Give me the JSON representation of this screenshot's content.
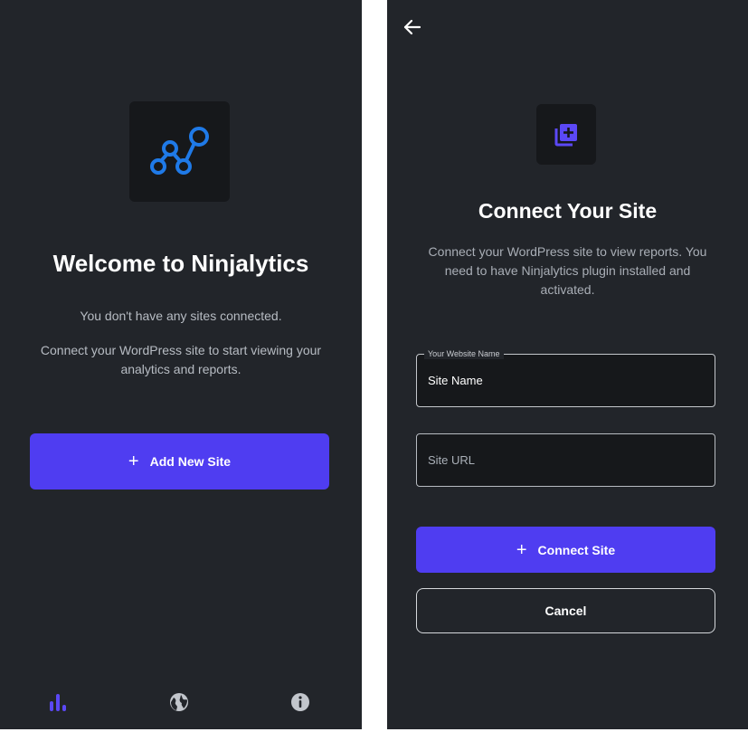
{
  "colors": {
    "background": "#22252a",
    "tile": "#16181b",
    "accent": "#4f3df1",
    "logo_blue": "#1f7ae8",
    "muted_text": "#b7bcc3"
  },
  "welcome": {
    "logo_icon": "network-graph-icon",
    "title": "Welcome to Ninjalytics",
    "empty_message": "You don't have any sites connected.",
    "connect_message": "Connect your WordPress site to start viewing your analytics and reports.",
    "add_button_label": "Add New Site",
    "add_button_icon": "plus-icon",
    "nav": [
      {
        "icon": "bar-chart-icon",
        "active": true
      },
      {
        "icon": "globe-icon",
        "active": false
      },
      {
        "icon": "info-icon",
        "active": false
      }
    ]
  },
  "connect": {
    "back_icon": "arrow-left-icon",
    "header_icon": "add-to-library-icon",
    "title": "Connect Your Site",
    "description": "Connect your WordPress site to view reports. You need to have Ninjalytics plugin installed and activated.",
    "name_field": {
      "label": "Your Website Name",
      "value": "Site Name"
    },
    "url_field": {
      "placeholder": "Site URL",
      "value": ""
    },
    "connect_button_label": "Connect Site",
    "connect_button_icon": "plus-icon",
    "cancel_button_label": "Cancel"
  }
}
